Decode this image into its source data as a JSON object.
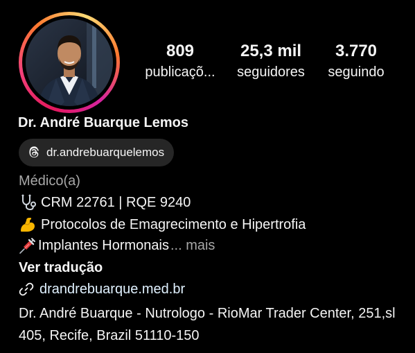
{
  "profile": {
    "stats": [
      {
        "value": "809",
        "label": "publicaçõ..."
      },
      {
        "value": "25,3 mil",
        "label": "seguidores"
      },
      {
        "value": "3.770",
        "label": "seguindo"
      }
    ],
    "name": "Dr. André Buarque Lemos",
    "threads_handle": "dr.andrebuarquelemos",
    "category": "Médico(a)",
    "bio": {
      "line1": "CRM 22761 | RQE 9240",
      "line2": "Protocolos de Emagrecimento e Hipertrofia",
      "line3": "Implantes Hormonais",
      "more": "... mais"
    },
    "translate_label": "Ver tradução",
    "website": "drandrebuarque.med.br",
    "address": "Dr. André Buarque - Nutrologo - RioMar Trader Center, 251,sl 405, Recife, Brazil 51110-150"
  },
  "colors": {
    "background": "#000000",
    "text": "#f5f5f5",
    "secondary_text": "#a8a8a8",
    "pill_background": "#262626",
    "link": "#e0f1ff"
  },
  "icons": {
    "threads": "threads-icon",
    "stethoscope": "stethoscope-icon",
    "flexed_biceps": "flexed-biceps-icon",
    "syringe": "syringe-icon",
    "link": "link-icon"
  }
}
